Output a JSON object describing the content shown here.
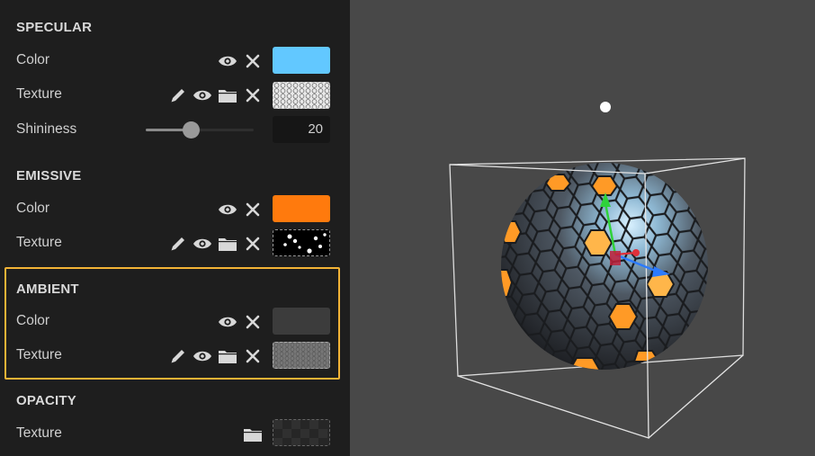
{
  "panel": {
    "specular": {
      "title": "SPECULAR",
      "color_label": "Color",
      "texture_label": "Texture",
      "shininess_label": "Shininess",
      "shininess_value": "20",
      "shininess_fraction": 0.42,
      "color": "#62c8ff"
    },
    "emissive": {
      "title": "EMISSIVE",
      "color_label": "Color",
      "texture_label": "Texture",
      "color": "#ff7a0d"
    },
    "ambient": {
      "title": "AMBIENT",
      "color_label": "Color",
      "texture_label": "Texture",
      "color": "#3c3c3c"
    },
    "opacity": {
      "title": "OPACITY",
      "texture_label": "Texture"
    }
  },
  "icons": {
    "visibility": "eye-icon",
    "clear": "close-icon",
    "edit": "pencil-icon",
    "browse": "folder-icon"
  },
  "colors": {
    "highlight": "#f3b336",
    "panel_bg": "#1e1e1e",
    "viewport_bg": "#484848"
  }
}
